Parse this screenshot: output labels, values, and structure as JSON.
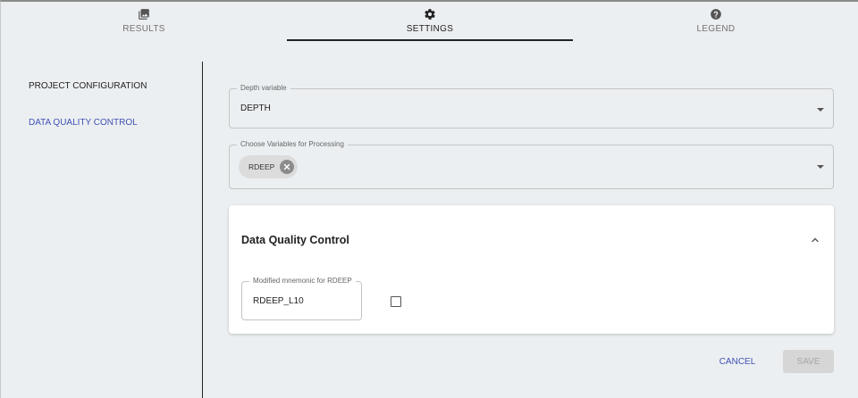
{
  "tabs": [
    {
      "label": "RESULTS",
      "icon": "image-icon",
      "active": false
    },
    {
      "label": "SETTINGS",
      "icon": "gear-icon",
      "active": true
    },
    {
      "label": "LEGEND",
      "icon": "help-circle-icon",
      "active": false
    }
  ],
  "sidenav": {
    "items": [
      {
        "label": "PROJECT CONFIGURATION",
        "active": false
      },
      {
        "label": "DATA QUALITY CONTROL",
        "active": true
      }
    ]
  },
  "depth_field": {
    "label": "Depth variable",
    "value": "DEPTH"
  },
  "variables_field": {
    "label": "Choose Variables for Processing",
    "chips": [
      "RDEEP"
    ]
  },
  "dq_card": {
    "title": "Data Quality Control",
    "mnemonic_field": {
      "label": "Modified mnemonic for RDEEP",
      "value": "RDEEP_L10"
    },
    "checkbox_checked": false
  },
  "actions": {
    "cancel_label": "CANCEL",
    "save_label": "SAVE"
  },
  "colors": {
    "accent": "#3f51b5",
    "background": "#eceff1",
    "card": "#ffffff",
    "disabled_button": "#d6d6d6"
  }
}
